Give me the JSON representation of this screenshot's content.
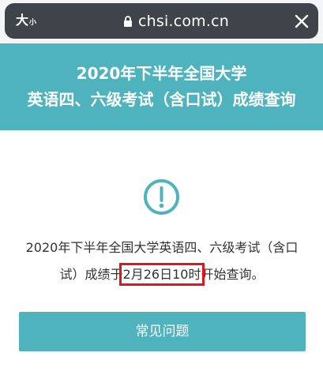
{
  "browser": {
    "text_size_large": "大",
    "text_size_small": "小",
    "url": "chsi.com.cn",
    "lock_icon": "lock-icon",
    "close_icon": "close-icon"
  },
  "header": {
    "line1": "2020年下半年全国大学",
    "line2": "英语四、六级考试（含口试）成绩查询"
  },
  "notice": {
    "icon": "exclamation-circle-icon",
    "text_before_line1": "2020年下半年全国大学英语四、六级考试（含口",
    "text_before_line2": "试）成绩于",
    "highlight": "2月26日10时",
    "text_after": "开始查询。"
  },
  "faq": {
    "label": "常见问题"
  },
  "colors": {
    "teal": "#4fb3bd",
    "address_bar": "#3f434a",
    "highlight_border": "#e0151b"
  }
}
